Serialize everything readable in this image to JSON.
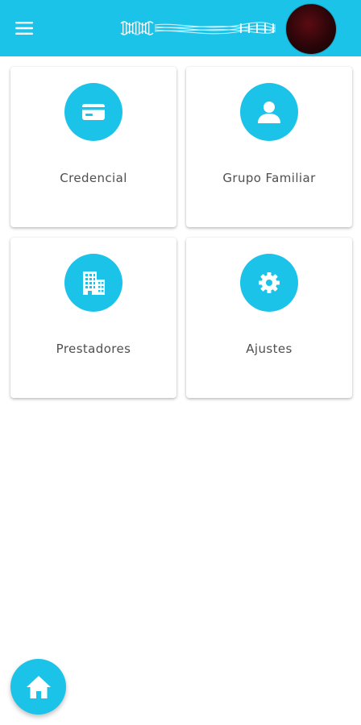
{
  "header": {
    "menu_icon": "hamburger-menu-icon",
    "logo": "brand-logo",
    "avatar": "user-avatar"
  },
  "cards": [
    {
      "label": "Credencial",
      "icon": "credit-card-icon"
    },
    {
      "label": "Grupo Familiar",
      "icon": "person-icon"
    },
    {
      "label": "Prestadores",
      "icon": "building-icon"
    },
    {
      "label": "Ajustes",
      "icon": "gear-icon"
    }
  ],
  "fab": {
    "icon": "home-icon"
  },
  "colors": {
    "accent": "#1cc3e8",
    "text": "#4f4f4f",
    "background": "#ffffff"
  }
}
